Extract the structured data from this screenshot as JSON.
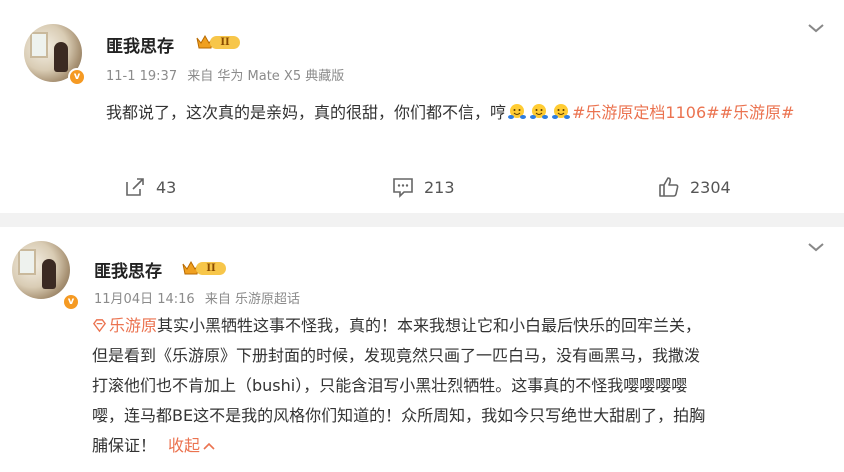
{
  "posts": [
    {
      "username": "匪我思存",
      "rank_label": "II",
      "verified_label": "v",
      "timestamp": "11-1 19:37",
      "source": "来自 华为 Mate X5 典藏版",
      "text_before": "我都说了，这次真的是亲妈，真的很甜，你们都不信，哼",
      "emojis": [
        "hug-emoji",
        "hug-emoji",
        "hug-emoji"
      ],
      "hashtag1": "#乐游原定档1106#",
      "hashtag2": "#乐游原#",
      "reposts": "43",
      "comments": "213",
      "likes": "2304"
    },
    {
      "username": "匪我思存",
      "rank_label": "II",
      "verified_label": "v",
      "timestamp": "11月04日 14:16",
      "source": "来自 乐游原超话",
      "supertopic": "乐游原",
      "text_line1": "其实小黑牺牲这事不怪我，真的！本来我想让它和小白最后快乐的回牢兰关，",
      "text_line2": "但是看到《乐游原》下册封面的时候，发现竟然只画了一匹白马，没有画黑马，我撒泼",
      "text_line3": "打滚他们也不肯加上（bushi），只能含泪写小黑壮烈牺牲。这事真的不怪我嘤嘤嘤嘤",
      "text_line4": "嘤，连马都BE这不是我的风格你们知道的！众所周知，我如今只写绝世大甜剧了，拍胸",
      "text_line5": "脯保证！",
      "collapse_label": "收起"
    }
  ],
  "colors": {
    "accent": "#eb7350",
    "meta": "#8b8b8b",
    "rank_gold": "#f7c64a",
    "verified": "#f59a23"
  }
}
